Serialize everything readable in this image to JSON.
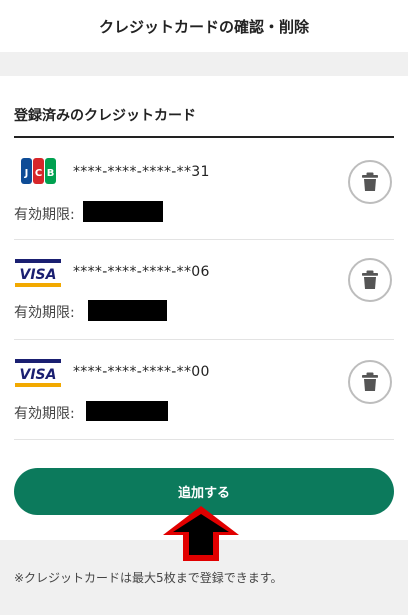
{
  "header": {
    "title": "クレジットカードの確認・削除"
  },
  "section": {
    "title": "登録済みのクレジットカード"
  },
  "cards": [
    {
      "brand": "JCB",
      "number": "****-****-****-**31",
      "expiry_label": "有効期限:"
    },
    {
      "brand": "VISA",
      "number": "****-****-****-**06",
      "expiry_label": "有効期限:"
    },
    {
      "brand": "VISA",
      "number": "****-****-****-**00",
      "expiry_label": "有効期限:"
    }
  ],
  "actions": {
    "add_label": "追加する"
  },
  "footer": {
    "note": "※クレジットカードは最大5枚まで登録できます。"
  },
  "colors": {
    "accent": "#0c7a5c",
    "arrow": "#e10000",
    "visa_blue": "#1a1f71",
    "visa_gold": "#f2a900",
    "jcb_blue": "#0e4c96",
    "jcb_red": "#d7262a",
    "jcb_green": "#00a150"
  },
  "icons": {
    "delete": "trash-icon",
    "pointer": "up-arrow-icon"
  }
}
